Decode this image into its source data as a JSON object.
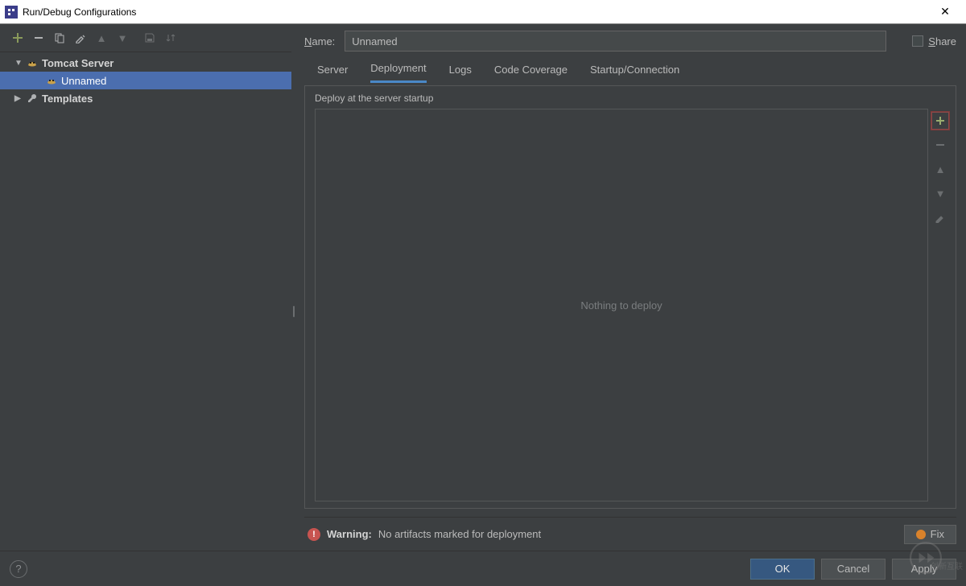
{
  "window": {
    "title": "Run/Debug Configurations"
  },
  "toolbar": {
    "add_tip": "Add",
    "remove_tip": "Remove",
    "copy_tip": "Copy",
    "edit_defaults_tip": "Edit defaults",
    "up_tip": "Up",
    "down_tip": "Down",
    "save_tip": "Save configuration",
    "sort_tip": "Sort"
  },
  "tree": {
    "items": [
      {
        "label": "Tomcat Server",
        "type": "group"
      },
      {
        "label": "Unnamed",
        "type": "config"
      },
      {
        "label": "Templates",
        "type": "group"
      }
    ]
  },
  "form": {
    "name_label": "Name:",
    "name_value": "Unnamed",
    "share_label": "Share"
  },
  "tabs": [
    {
      "label": "Server"
    },
    {
      "label": "Deployment",
      "active": true
    },
    {
      "label": "Logs"
    },
    {
      "label": "Code Coverage"
    },
    {
      "label": "Startup/Connection"
    }
  ],
  "deployment": {
    "heading": "Deploy at the server startup",
    "placeholder": "Nothing to deploy"
  },
  "warning": {
    "label": "Warning:",
    "message": "No artifacts marked for deployment",
    "fix_label": "Fix"
  },
  "buttons": {
    "ok": "OK",
    "cancel": "Cancel",
    "apply": "Apply"
  }
}
